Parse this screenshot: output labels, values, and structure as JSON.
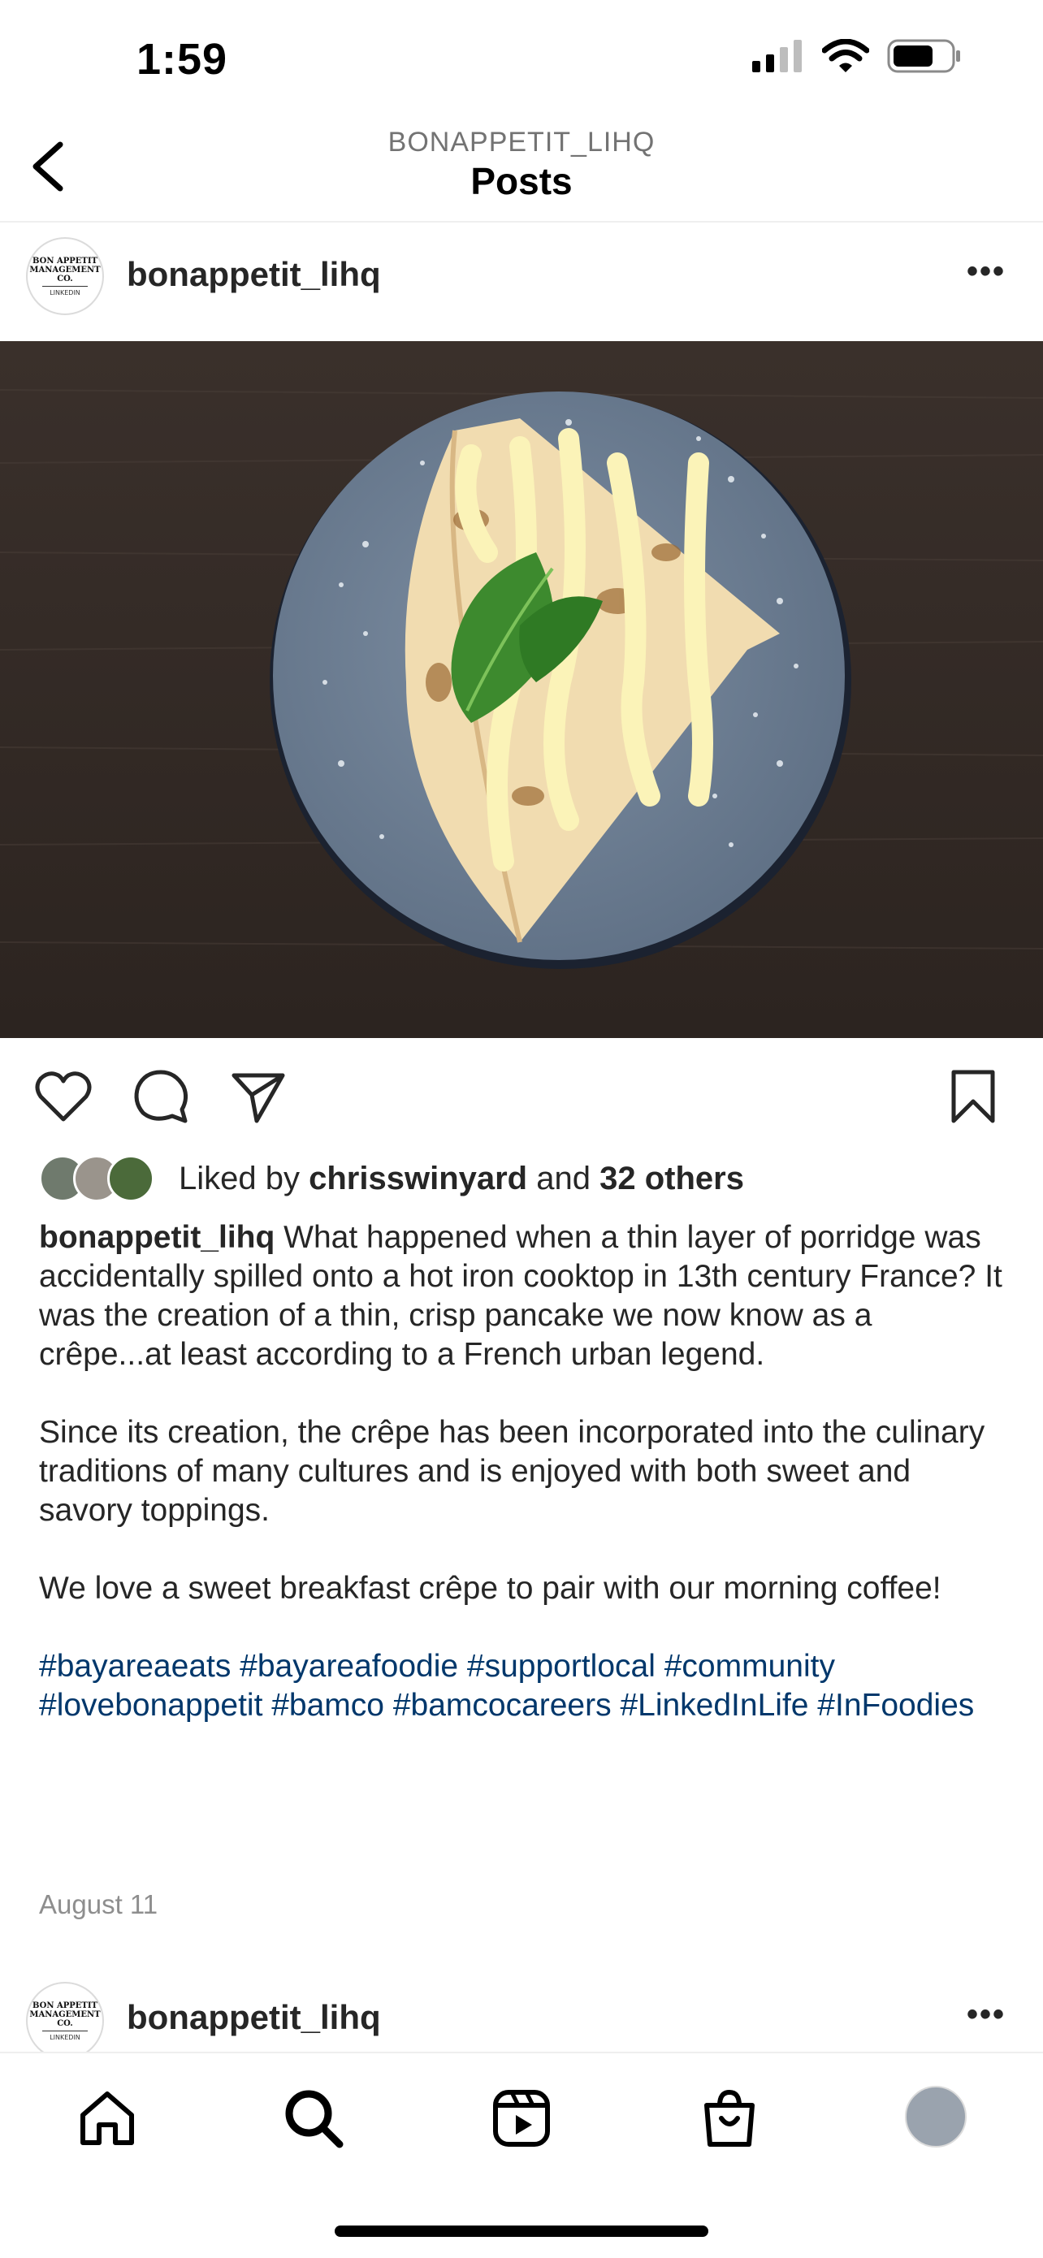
{
  "status_bar": {
    "time": "1:59"
  },
  "header": {
    "subtitle": "BONAPPETIT_LIHQ",
    "title": "Posts"
  },
  "post": {
    "avatar_text_line1": "BON APPETIT",
    "avatar_text_line2": "MANAGEMENT CO.",
    "avatar_text_line3": "LINKEDIN",
    "username": "bonappetit_lihq",
    "more": "•••",
    "likes_prefix": "Liked by",
    "liked_by": "chrisswinyard",
    "likes_and": "and",
    "likes_others": "32 others",
    "caption_username": "bonappetit_lihq",
    "caption_p1": "What happened when a thin layer of porridge was accidentally spilled onto a hot iron cooktop in 13th century France? It was the creation of a thin, crisp pancake we now know as a crêpe...at least according to a French urban legend.",
    "caption_p2": "Since its creation, the crêpe has been incorporated into the culinary traditions of many cultures and is enjoyed with both sweet and savory toppings.",
    "caption_p3": "We love a sweet breakfast crêpe to pair with our morning coffee!",
    "hashtags": " #bayareaeats #bayareafoodie #supportlocal #community #lovebonappetit #bamco #bamcocareers  #LinkedInLife #InFoodies",
    "date": "August 11"
  },
  "next_post": {
    "username": "bonappetit_lihq",
    "more": "•••"
  },
  "tabs": [
    "home-icon",
    "search-icon",
    "reels-icon",
    "shop-icon",
    "profile-avatar"
  ],
  "colors": {
    "hashtag": "#00376b",
    "muted": "#8e8e8e",
    "text": "#262626"
  }
}
